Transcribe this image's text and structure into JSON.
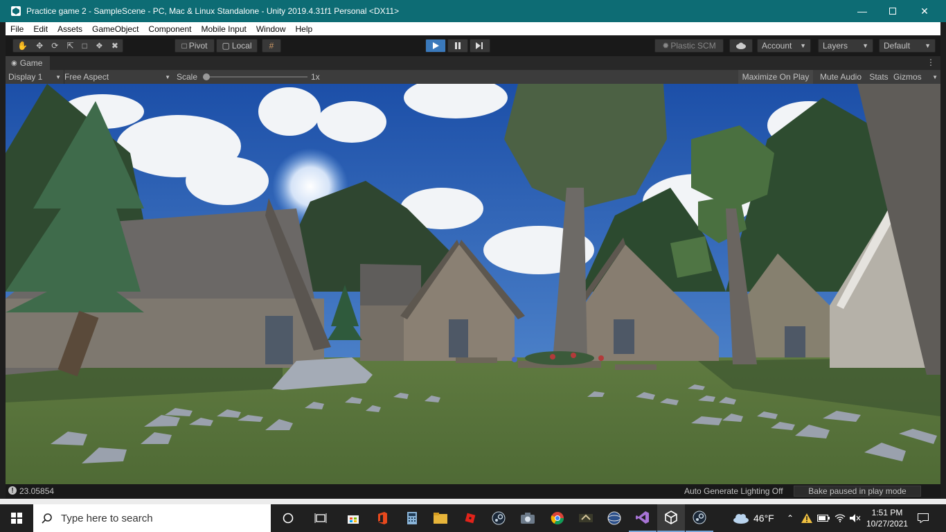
{
  "window": {
    "title": "Practice game 2 - SampleScene - PC, Mac & Linux Standalone - Unity 2019.4.31f1 Personal <DX11>"
  },
  "menu": [
    "File",
    "Edit",
    "Assets",
    "GameObject",
    "Component",
    "Mobile Input",
    "Window",
    "Help"
  ],
  "toolbar": {
    "pivot_label": "Pivot",
    "local_label": "Local",
    "plastic_label": "Plastic SCM",
    "account_label": "Account",
    "layers_label": "Layers",
    "layout_label": "Default"
  },
  "game_tab": {
    "label": "Game"
  },
  "game_toolbar": {
    "display": "Display 1",
    "aspect": "Free Aspect",
    "scale_label": "Scale",
    "scale_value": "1x",
    "maximize": "Maximize On Play",
    "mute": "Mute Audio",
    "stats": "Stats",
    "gizmos": "Gizmos"
  },
  "status": {
    "message": "23.05854",
    "lighting": "Auto Generate Lighting Off",
    "bake": "Bake paused in play mode"
  },
  "taskbar": {
    "search_placeholder": "Type here to search",
    "weather": "46°F",
    "time": "1:51 PM",
    "date": "10/27/2021"
  },
  "colors": {
    "titlebar": "#0d6c74",
    "play_active": "#3a79bb",
    "sky": "#2f6fc4",
    "grass": "#5b7a3c"
  }
}
